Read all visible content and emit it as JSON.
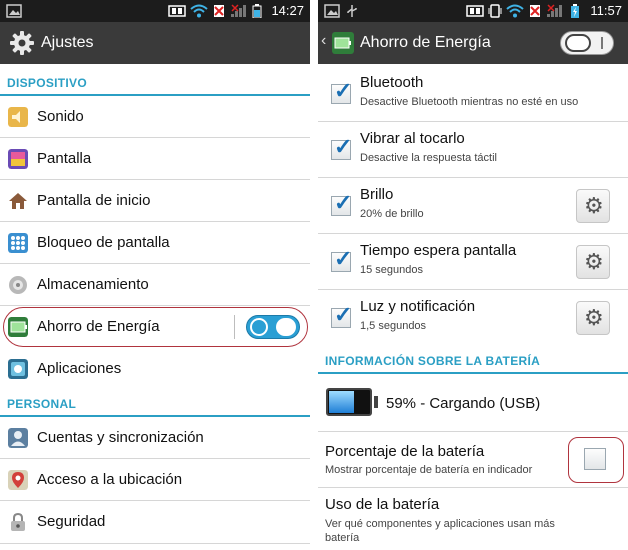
{
  "left": {
    "status": {
      "time": "14:27"
    },
    "header": {
      "title": "Ajustes"
    },
    "sections": [
      {
        "title": "DISPOSITIVO"
      },
      {
        "title": "PERSONAL"
      }
    ],
    "items": [
      {
        "label": "Sonido",
        "icon": "speaker-icon"
      },
      {
        "label": "Pantalla",
        "icon": "display-icon"
      },
      {
        "label": "Pantalla de inicio",
        "icon": "home-icon"
      },
      {
        "label": "Bloqueo de pantalla",
        "icon": "lock-grid-icon"
      },
      {
        "label": "Almacenamiento",
        "icon": "storage-icon"
      },
      {
        "label": "Ahorro de Energía",
        "icon": "battery-saver-icon",
        "toggle": "on"
      },
      {
        "label": "Aplicaciones",
        "icon": "apps-icon"
      },
      {
        "label": "Cuentas y sincronización",
        "icon": "accounts-icon"
      },
      {
        "label": "Acceso a la ubicación",
        "icon": "location-icon"
      },
      {
        "label": "Seguridad",
        "icon": "security-icon"
      }
    ]
  },
  "right": {
    "status": {
      "time": "11:57"
    },
    "header": {
      "title": "Ahorro de Energía",
      "toggle": "on"
    },
    "options": [
      {
        "title": "Bluetooth",
        "subtitle": "Desactive Bluetooth mientras no esté en uso",
        "checked": true
      },
      {
        "title": "Vibrar al tocarlo",
        "subtitle": "Desactive la respuesta táctil",
        "checked": true
      },
      {
        "title": "Brillo",
        "subtitle": "20% de brillo",
        "checked": true,
        "settings": true
      },
      {
        "title": "Tiempo espera pantalla",
        "subtitle": "15 segundos",
        "checked": true,
        "settings": true
      },
      {
        "title": "Luz y notificación",
        "subtitle": "1,5 segundos",
        "checked": true,
        "settings": true
      }
    ],
    "battery_section": {
      "title": "INFORMACIÓN SOBRE LA BATERÍA"
    },
    "battery": {
      "status": "59% - Cargando (USB)",
      "level": 0.59
    },
    "percentage": {
      "title": "Porcentaje de la batería",
      "subtitle": "Mostrar porcentaje de batería en indicador",
      "checked": false
    },
    "usage": {
      "title": "Uso de la batería",
      "subtitle": "Ver qué componentes y aplicaciones usan más batería"
    }
  },
  "colors": {
    "accent": "#2b9fc4",
    "highlight": "#b0343e",
    "toggle_on": "#2a9fd4"
  }
}
